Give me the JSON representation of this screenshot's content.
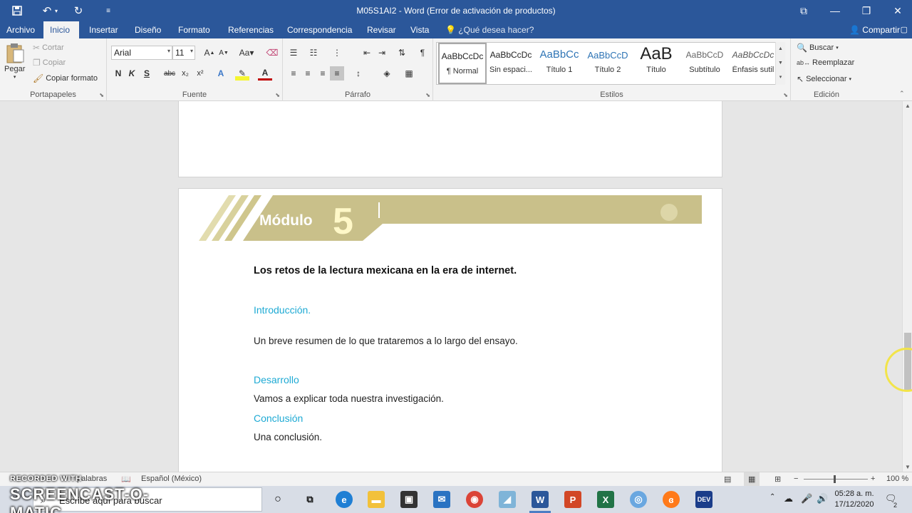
{
  "window": {
    "title": "M05S1AI2 - Word (Error de activación de productos)",
    "quick_access": {
      "save_icon": "save-icon",
      "undo_icon": "undo-icon",
      "redo_icon": "redo-icon"
    }
  },
  "tabs": [
    "Archivo",
    "Inicio",
    "Insertar",
    "Diseño",
    "Formato",
    "Referencias",
    "Correspondencia",
    "Revisar",
    "Vista"
  ],
  "active_tab": "Inicio",
  "tell_me": "¿Qué desea hacer?",
  "share_label": "Compartir",
  "ribbon": {
    "clipboard": {
      "paste": "Pegar",
      "cut": "Cortar",
      "copy": "Copiar",
      "format_painter": "Copiar formato",
      "label": "Portapapeles"
    },
    "font": {
      "family": "Arial",
      "size": "11",
      "bold": "N",
      "italic": "K",
      "underline": "S",
      "strike": "abc",
      "subscript": "x₂",
      "superscript": "x²",
      "label": "Fuente"
    },
    "paragraph": {
      "label": "Párrafo"
    },
    "styles": {
      "label": "Estilos",
      "items": [
        {
          "sample": "AaBbCcDc",
          "name": "¶ Normal"
        },
        {
          "sample": "AaBbCcDc",
          "name": "Sin espaci..."
        },
        {
          "sample": "AaBbCc",
          "name": "Título 1"
        },
        {
          "sample": "AaBbCcD",
          "name": "Título 2"
        },
        {
          "sample": "AaB",
          "name": "Título"
        },
        {
          "sample": "AaBbCcD",
          "name": "Subtítulo"
        },
        {
          "sample": "AaBbCcDc",
          "name": "Énfasis sutil"
        }
      ]
    },
    "editing": {
      "find": "Buscar",
      "replace": "Reemplazar",
      "select": "Seleccionar",
      "label": "Edición"
    }
  },
  "document": {
    "banner_word": "Módulo",
    "banner_number": "5",
    "title": "Los retos de la lectura mexicana en la era de internet.",
    "sections": [
      {
        "heading": "Introducción.",
        "text": "Un breve resumen de lo que trataremos a lo largo del ensayo."
      },
      {
        "heading": "Desarrollo",
        "text": "Vamos a explicar toda nuestra investigación."
      },
      {
        "heading": "Conclusión",
        "text": "Una conclusión."
      }
    ]
  },
  "statusbar": {
    "words": "palabras",
    "language": "Español (México)",
    "zoom": "100 %"
  },
  "taskbar": {
    "search_placeholder": "Escribe aquí para buscar",
    "time": "05:28 a. m.",
    "date": "17/12/2020",
    "notification_count": "2"
  },
  "watermark": {
    "top": "RECORDED WITH",
    "bottom": "SCREENCAST-O-MATIC"
  },
  "colors": {
    "word_blue": "#2b579a",
    "heading_cyan": "#1eaad4",
    "banner_gold": "#c9c08a"
  }
}
